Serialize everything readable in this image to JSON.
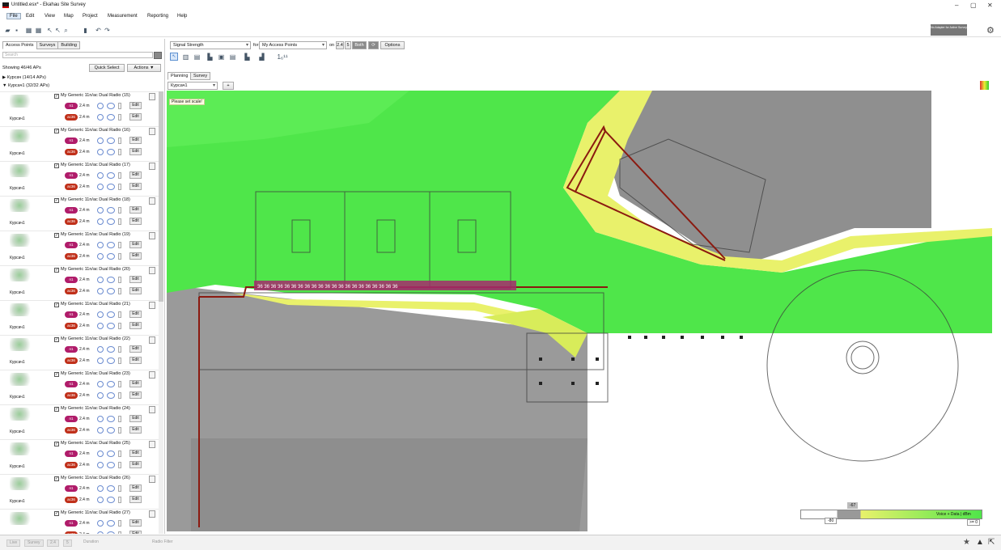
{
  "app": {
    "title": "Untitled.esx* - Ekahau Site Survey"
  },
  "window_controls": [
    "–",
    "▢",
    "✕"
  ],
  "menu": [
    "File",
    "Edit",
    "View",
    "Map",
    "Project",
    "Measurement",
    "Reporting",
    "Help"
  ],
  "adapter": {
    "text": "No Adapter for Active Survey"
  },
  "left": {
    "tabs": [
      "Access Points",
      "Surveys",
      "Building"
    ],
    "search_placeholder": "Search",
    "showing": "Showing 46/46 APs",
    "quick_select": "Quick Select",
    "actions": "Actions ▼",
    "groups": [
      "Курсач (14/14 APs)",
      "Курсач1 (32/32 APs)"
    ],
    "aps": [
      {
        "name": "My Generic 11n/ac Dual Radio (15)",
        "floor": "Курсач1",
        "r1": "n1",
        "r2": "ac36",
        "h": "2.4 m",
        "edit": "Edit"
      },
      {
        "name": "My Generic 11n/ac Dual Radio (16)",
        "floor": "Курсач1",
        "r1": "n1",
        "r2": "ac36",
        "h": "2.4 m",
        "edit": "Edit"
      },
      {
        "name": "My Generic 11n/ac Dual Radio (17)",
        "floor": "Курсач1",
        "r1": "n1",
        "r2": "ac36",
        "h": "2.4 m",
        "edit": "Edit"
      },
      {
        "name": "My Generic 11n/ac Dual Radio (18)",
        "floor": "Курсач1",
        "r1": "n1",
        "r2": "ac36",
        "h": "2.4 m",
        "edit": "Edit"
      },
      {
        "name": "My Generic 11n/ac Dual Radio (19)",
        "floor": "Курсач1",
        "r1": "n1",
        "r2": "ac36",
        "h": "2.4 m",
        "edit": "Edit"
      },
      {
        "name": "My Generic 11n/ac Dual Radio (20)",
        "floor": "Курсач1",
        "r1": "n1",
        "r2": "ac36",
        "h": "2.4 m",
        "edit": "Edit"
      },
      {
        "name": "My Generic 11n/ac Dual Radio (21)",
        "floor": "Курсач1",
        "r1": "n1",
        "r2": "ac36",
        "h": "2.4 m",
        "edit": "Edit"
      },
      {
        "name": "My Generic 11n/ac Dual Radio (22)",
        "floor": "Курсач1",
        "r1": "n1",
        "r2": "ac36",
        "h": "2.4 m",
        "edit": "Edit"
      },
      {
        "name": "My Generic 11n/ac Dual Radio (23)",
        "floor": "Курсач1",
        "r1": "n1",
        "r2": "ac36",
        "h": "2.4 m",
        "edit": "Edit"
      },
      {
        "name": "My Generic 11n/ac Dual Radio (24)",
        "floor": "Курсач1",
        "r1": "n1",
        "r2": "ac36",
        "h": "2.4 m",
        "edit": "Edit"
      },
      {
        "name": "My Generic 11n/ac Dual Radio (25)",
        "floor": "Курсач1",
        "r1": "n1",
        "r2": "ac36",
        "h": "2.4 m",
        "edit": "Edit"
      },
      {
        "name": "My Generic 11n/ac Dual Radio (26)",
        "floor": "Курсач1",
        "r1": "n1",
        "r2": "ac36",
        "h": "2.4 m",
        "edit": "Edit"
      },
      {
        "name": "My Generic 11n/ac Dual Radio (27)",
        "floor": "Курсач1",
        "r1": "n1",
        "r2": "ac36",
        "h": "2.4 m",
        "edit": "Edit"
      }
    ]
  },
  "viz": {
    "view": "Signal Strength",
    "for_label": "for",
    "target": "My Access Points",
    "on_label": "on",
    "band_24": "2.4",
    "band_5": "5",
    "band_both": "Both",
    "options": "Options",
    "tabs": [
      "Planning",
      "Survey"
    ],
    "floor": "Курсач1",
    "add": "+"
  },
  "map": {
    "warning": "Please set scale!"
  },
  "legend": {
    "threshold": "-67",
    "min": "-80",
    "label": "Voice + Data | dBm",
    "right": ">= 0"
  },
  "status": {
    "items": [
      "Live",
      "Survey",
      "2.4",
      "5",
      "Duration",
      "Radio Filter"
    ]
  },
  "colors": {
    "accent": "#2a7ae2",
    "pill1": "#b01c6a",
    "pill2": "#c0301a",
    "heat_strong": "#4fe64a",
    "heat_weak": "#e9f16b"
  }
}
